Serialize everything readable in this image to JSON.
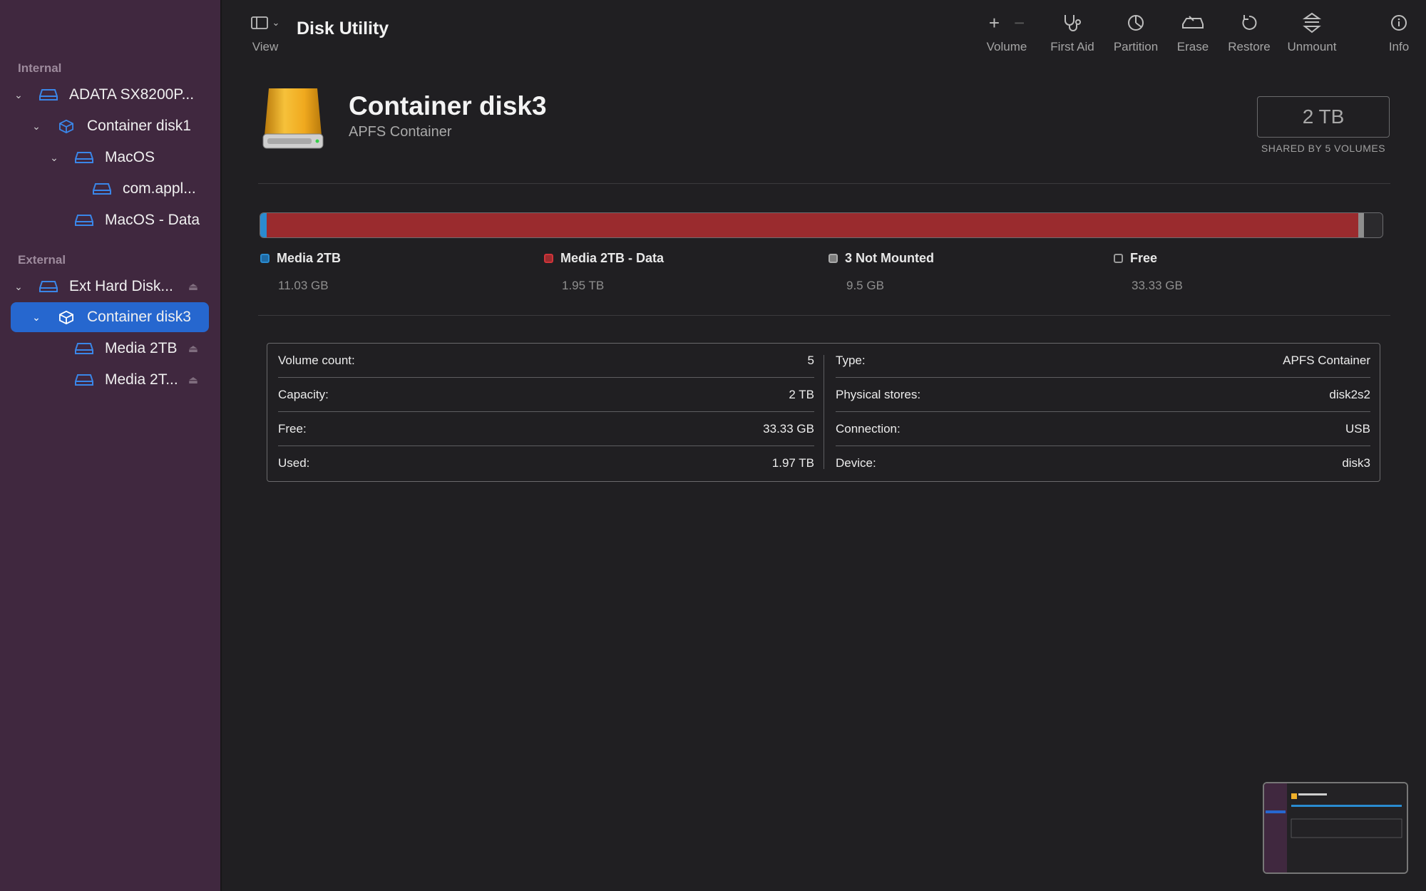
{
  "toolbar": {
    "view_label": "View",
    "title": "Disk Utility",
    "volume_label": "Volume",
    "first_aid_label": "First Aid",
    "partition_label": "Partition",
    "erase_label": "Erase",
    "restore_label": "Restore",
    "unmount_label": "Unmount",
    "info_label": "Info"
  },
  "sidebar": {
    "internal_title": "Internal",
    "external_title": "External",
    "items": [
      {
        "label": "ADATA SX8200P..."
      },
      {
        "label": "Container disk1"
      },
      {
        "label": "MacOS"
      },
      {
        "label": "com.appl..."
      },
      {
        "label": "MacOS - Data"
      },
      {
        "label": "Ext Hard Disk..."
      },
      {
        "label": "Container disk3"
      },
      {
        "label": "Media 2TB"
      },
      {
        "label": "Media 2T..."
      }
    ]
  },
  "header": {
    "title": "Container disk3",
    "subtitle": "APFS Container",
    "capacity": "2 TB",
    "shared_text": "SHARED BY 5 VOLUMES"
  },
  "usage": {
    "colors": {
      "media": "#2a8bd0",
      "data": "#9a2b2e",
      "not_mounted": "#8e8e8e",
      "free": "#2b2a2d"
    },
    "segments_fraction": {
      "media": 0.0055,
      "data": 0.975,
      "not_mounted": 0.0047,
      "free": 0.0167
    },
    "legend": [
      {
        "name": "Media 2TB",
        "value": "11.03 GB"
      },
      {
        "name": "Media 2TB - Data",
        "value": "1.95 TB"
      },
      {
        "name": "3 Not Mounted",
        "value": "9.5 GB"
      },
      {
        "name": "Free",
        "value": "33.33 GB"
      }
    ]
  },
  "info": {
    "left": [
      {
        "label": "Volume count:",
        "value": "5"
      },
      {
        "label": "Capacity:",
        "value": "2 TB"
      },
      {
        "label": "Free:",
        "value": "33.33 GB"
      },
      {
        "label": "Used:",
        "value": "1.97 TB"
      }
    ],
    "right": [
      {
        "label": "Type:",
        "value": "APFS Container"
      },
      {
        "label": "Physical stores:",
        "value": "disk2s2"
      },
      {
        "label": "Connection:",
        "value": "USB"
      },
      {
        "label": "Device:",
        "value": "disk3"
      }
    ]
  }
}
